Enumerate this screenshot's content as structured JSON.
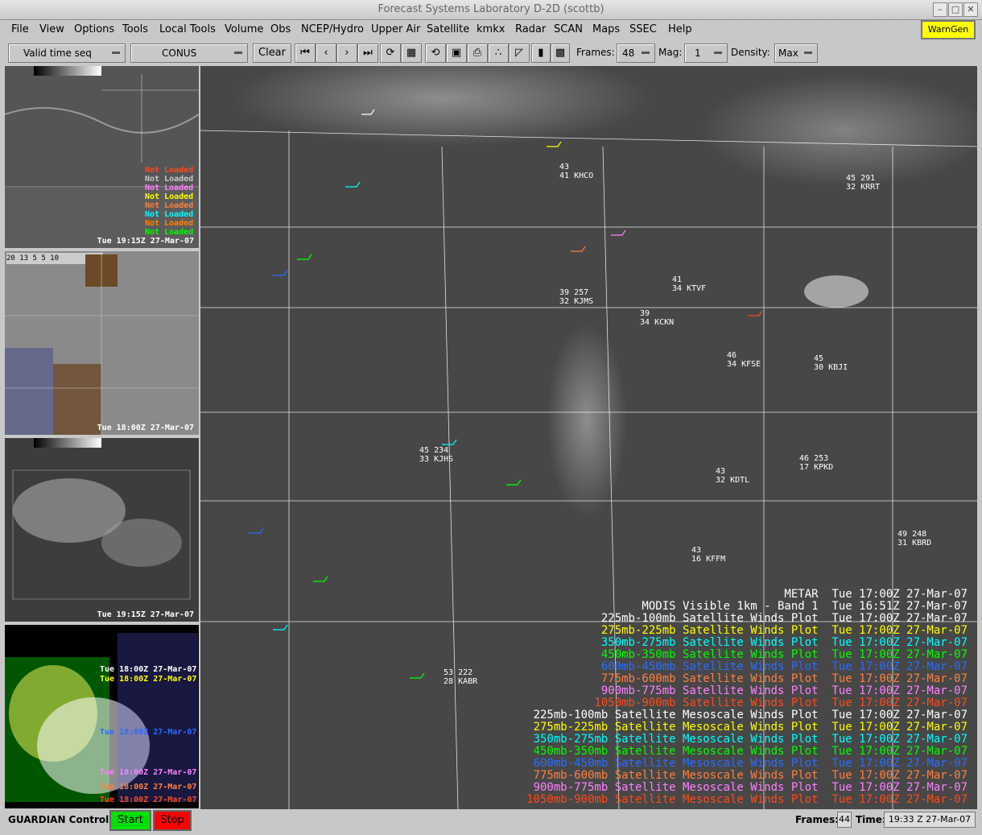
{
  "window": {
    "title": "Forecast Systems Laboratory D-2D (scottb)"
  },
  "menu": {
    "items": [
      "File",
      "View",
      "Options",
      "Tools",
      "Local Tools",
      "Volume",
      "Obs",
      "NCEP/Hydro",
      "Upper Air",
      "Satellite",
      "kmkx",
      "Radar",
      "SCAN",
      "Maps",
      "SSEC",
      "Help"
    ],
    "warngen": "WarnGen"
  },
  "toolbar": {
    "time_mode": "Valid time seq",
    "scale": "CONUS",
    "clear_label": "Clear",
    "frames_label": "Frames:",
    "frames_value": "48",
    "mag_label": "Mag:",
    "mag_value": "1",
    "density_label": "Density:",
    "density_value": "Max"
  },
  "side_panes": {
    "pane1_labels": [
      {
        "text": "Not Loaded",
        "color": "#ff4a1c"
      },
      {
        "text": "Not Loaded",
        "color": "#c8c8c8"
      },
      {
        "text": "Not Loaded",
        "color": "#ff80ff"
      },
      {
        "text": "Not Loaded",
        "color": "#ffff00"
      },
      {
        "text": "Not Loaded",
        "color": "#ff8040"
      },
      {
        "text": "Not Loaded",
        "color": "#00ffff"
      },
      {
        "text": "Not Loaded",
        "color": "#ff8000"
      },
      {
        "text": "Not Loaded",
        "color": "#00ff00"
      }
    ],
    "pane1_time": "Tue 19:15Z 27-Mar-07",
    "pane2_scale": "20 13 5  5 10",
    "pane2_time": "Tue 18:00Z 27-Mar-07",
    "pane3_time": "Tue 19:15Z 27-Mar-07",
    "pane4_times": [
      "Tue 18:00Z 27-Mar-07",
      "Tue 18:00Z 27-Mar-07",
      "Tue 18:00Z 27-Mar-07",
      "Tue 18:00Z 27-Mar-07",
      "Tue 18:00Z 27-Mar-07",
      "Tue 18:00Z 27-Mar-07"
    ]
  },
  "legend": [
    {
      "text": "METAR  Tue 17:00Z 27-Mar-07",
      "color": "#ffffff"
    },
    {
      "text": "MODIS Visible 1km - Band 1  Tue 16:51Z 27-Mar-07",
      "color": "#ffffff"
    },
    {
      "text": "225mb-100mb Satellite Winds Plot  Tue 17:00Z 27-Mar-07",
      "color": "#ffffff"
    },
    {
      "text": "275mb-225mb Satellite Winds Plot  Tue 17:00Z 27-Mar-07",
      "color": "#ffff00"
    },
    {
      "text": "350mb-275mb Satellite Winds Plot  Tue 17:00Z 27-Mar-07",
      "color": "#00ffff"
    },
    {
      "text": "450mb-350mb Satellite Winds Plot  Tue 17:00Z 27-Mar-07",
      "color": "#00ff00"
    },
    {
      "text": "600mb-450mb Satellite Winds Plot  Tue 17:00Z 27-Mar-07",
      "color": "#2a6cff"
    },
    {
      "text": "775mb-600mb Satellite Winds Plot  Tue 17:00Z 27-Mar-07",
      "color": "#ff8040"
    },
    {
      "text": "900mb-775mb Satellite Winds Plot  Tue 17:00Z 27-Mar-07",
      "color": "#ff80ff"
    },
    {
      "text": "1050mb-900mb Satellite Winds Plot  Tue 17:00Z 27-Mar-07",
      "color": "#ff4a1c"
    },
    {
      "text": "225mb-100mb Satellite Mesoscale Winds Plot  Tue 17:00Z 27-Mar-07",
      "color": "#ffffff"
    },
    {
      "text": "275mb-225mb Satellite Mesoscale Winds Plot  Tue 17:00Z 27-Mar-07",
      "color": "#ffff00"
    },
    {
      "text": "350mb-275mb Satellite Mesoscale Winds Plot  Tue 17:00Z 27-Mar-07",
      "color": "#00ffff"
    },
    {
      "text": "450mb-350mb Satellite Mesoscale Winds Plot  Tue 17:00Z 27-Mar-07",
      "color": "#00ff00"
    },
    {
      "text": "600mb-450mb Satellite Mesoscale Winds Plot  Tue 17:00Z 27-Mar-07",
      "color": "#2a6cff"
    },
    {
      "text": "775mb-600mb Satellite Mesoscale Winds Plot  Tue 17:00Z 27-Mar-07",
      "color": "#ff8040"
    },
    {
      "text": "900mb-775mb Satellite Mesoscale Winds Plot  Tue 17:00Z 27-Mar-07",
      "color": "#ff80ff"
    },
    {
      "text": "1050mb-900mb Satellite Mesoscale Winds Plot  Tue 17:00Z 27-Mar-07",
      "color": "#ff4a1c"
    }
  ],
  "stations": [
    {
      "id": "KHCO",
      "t": "43",
      "d": "41"
    },
    {
      "id": "KJMS",
      "t": "39",
      "d": "32",
      "p": "257"
    },
    {
      "id": "KTVF",
      "t": "41",
      "d": "34"
    },
    {
      "id": "KCKN",
      "t": "39",
      "d": "34"
    },
    {
      "id": "KFSE",
      "t": "46",
      "d": "34"
    },
    {
      "id": "KBJI",
      "t": "45",
      "d": "30"
    },
    {
      "id": "KJHS",
      "t": "45",
      "d": "33",
      "p": "234"
    },
    {
      "id": "KDTL",
      "t": "43",
      "d": "32"
    },
    {
      "id": "KPKD",
      "t": "46",
      "d": "17",
      "p": "253"
    },
    {
      "id": "KFFM",
      "t": "43",
      "d": "16"
    },
    {
      "id": "KABR",
      "t": "53",
      "d": "28",
      "p": "222"
    },
    {
      "id": "KBRD",
      "t": "49",
      "d": "31",
      "p": "248"
    },
    {
      "id": "KRRT",
      "t": "45",
      "d": "32",
      "p": "291"
    }
  ],
  "status": {
    "guardian_label": "GUARDIAN Controls:",
    "start_label": "Start",
    "stop_label": "Stop",
    "frames_label": "Frames:",
    "frames_value": "44",
    "time_label": "Time:",
    "time_value": "19:33 Z 27-Mar-07"
  }
}
